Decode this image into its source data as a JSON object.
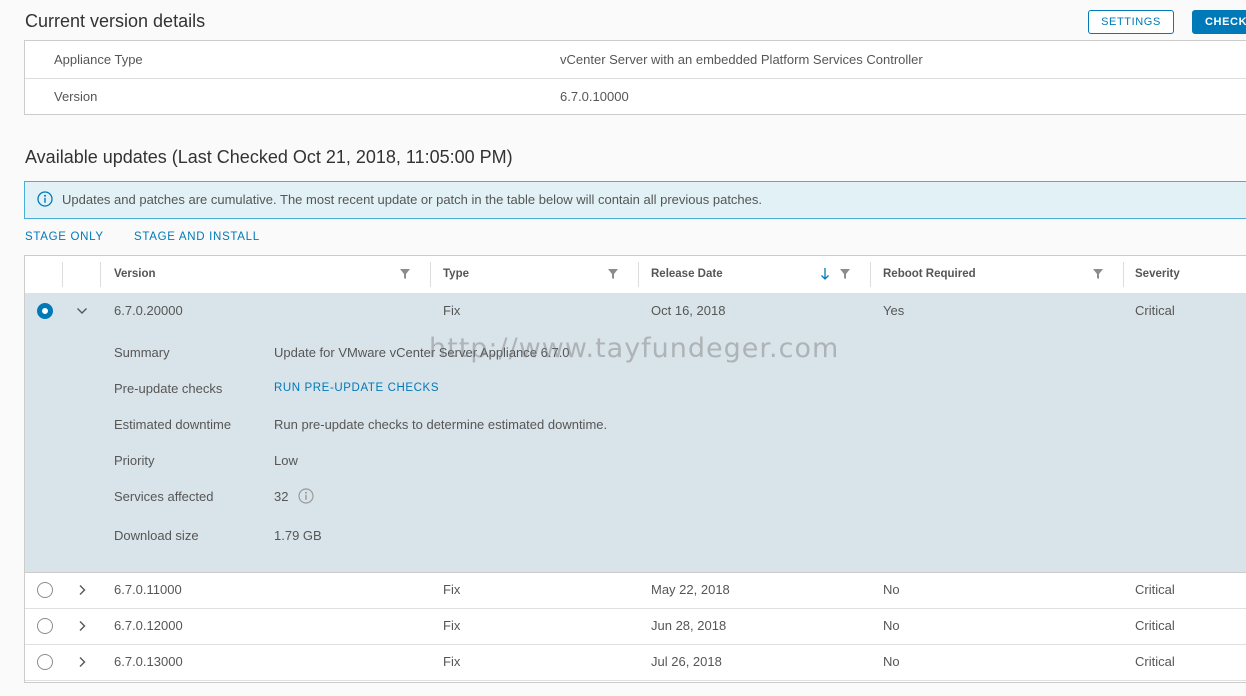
{
  "header": {
    "title": "Current version details",
    "settings_label": "SETTINGS",
    "check_label": "CHECK"
  },
  "details": {
    "appliance_type_label": "Appliance Type",
    "appliance_type_value": "vCenter Server with an embedded Platform Services Controller",
    "version_label": "Version",
    "version_value": "6.7.0.10000"
  },
  "updates": {
    "title": "Available updates (Last Checked Oct 21, 2018, 11:05:00 PM)",
    "info_text": "Updates and patches are cumulative. The most recent update or patch in the table below will contain all previous patches.",
    "stage_only_label": "STAGE ONLY",
    "stage_install_label": "STAGE AND INSTALL"
  },
  "table": {
    "columns": [
      "Version",
      "Type",
      "Release Date",
      "Reboot Required",
      "Severity"
    ],
    "rows": [
      {
        "version": "6.7.0.20000",
        "type": "Fix",
        "release_date": "Oct 16, 2018",
        "reboot": "Yes",
        "severity": "Critical"
      },
      {
        "version": "6.7.0.11000",
        "type": "Fix",
        "release_date": "May 22, 2018",
        "reboot": "No",
        "severity": "Critical"
      },
      {
        "version": "6.7.0.12000",
        "type": "Fix",
        "release_date": "Jun 28, 2018",
        "reboot": "No",
        "severity": "Critical"
      },
      {
        "version": "6.7.0.13000",
        "type": "Fix",
        "release_date": "Jul 26, 2018",
        "reboot": "No",
        "severity": "Critical"
      }
    ],
    "expanded": {
      "summary_label": "Summary",
      "summary_value": "Update for VMware vCenter Server Appliance 6.7.0",
      "precheck_label": "Pre-update checks",
      "precheck_link": "RUN PRE-UPDATE CHECKS",
      "downtime_label": "Estimated downtime",
      "downtime_value": "Run pre-update checks to determine estimated downtime.",
      "priority_label": "Priority",
      "priority_value": "Low",
      "services_label": "Services affected",
      "services_value": "32",
      "download_label": "Download size",
      "download_value": "1.79 GB"
    }
  },
  "watermark": "http://www.tayfundeger.com",
  "colors": {
    "accent": "#0079b8",
    "info_bg": "#e1f1f6",
    "selected_row_bg": "#d9e4ea"
  }
}
